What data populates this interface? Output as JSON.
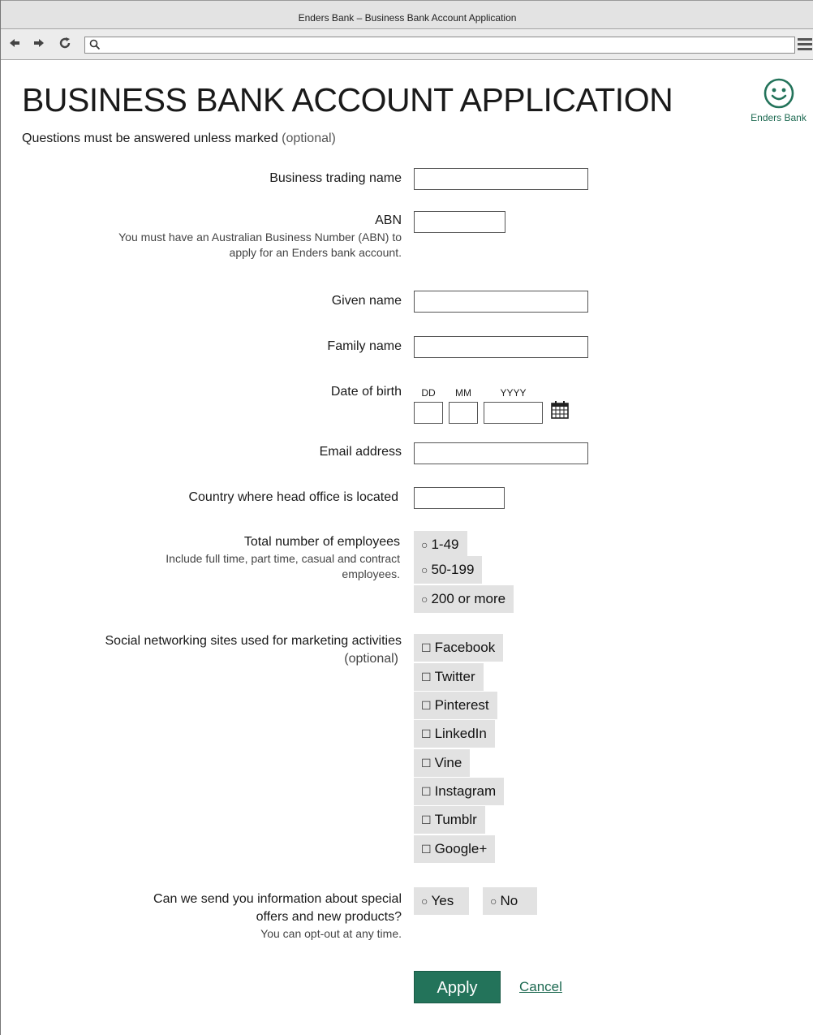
{
  "window": {
    "title": "Enders Bank – Business Bank Account Application"
  },
  "toolbar": {
    "back_icon": "arrow-left",
    "forward_icon": "arrow-right",
    "reload_icon": "reload",
    "search_icon": "magnifier",
    "menu_icon": "hamburger",
    "url_value": ""
  },
  "header": {
    "title": "BUSINESS BANK ACCOUNT APPLICATION",
    "brand_name": "Enders Bank",
    "brand_icon": "smiley-face",
    "intro_text": "Questions must be answered unless marked",
    "intro_optional": "(optional)"
  },
  "form": {
    "trading_name": {
      "label": "Business trading name",
      "value": ""
    },
    "abn": {
      "label": "ABN",
      "hint_line1": "You must have an Australian Business Number (ABN) to",
      "hint_line2": "apply for an Enders bank account.",
      "value": ""
    },
    "given_name": {
      "label": "Given name",
      "value": ""
    },
    "family_name": {
      "label": "Family name",
      "value": ""
    },
    "dob": {
      "label": "Date of birth",
      "day_label": "DD",
      "month_label": "MM",
      "year_label": "YYYY",
      "calendar_icon": "calendar"
    },
    "email": {
      "label": "Email address",
      "value": ""
    },
    "country": {
      "label": "Country where head office is located",
      "value": ""
    },
    "employees": {
      "label": "Total number of employees",
      "hint_line1": "Include full time, part time, casual and contract",
      "hint_line2": "employees.",
      "options": [
        "1-49",
        "50-199",
        "200 or more"
      ]
    },
    "social": {
      "label": "Social networking sites used for marketing activities",
      "optional": "(optional)",
      "options": [
        "Facebook",
        "Twitter",
        "Pinterest",
        "LinkedIn",
        "Vine",
        "Instagram",
        "Tumblr",
        "Google+"
      ]
    },
    "offers": {
      "label_line1": "Can we send you information about special",
      "label_line2": "offers and new products?",
      "hint": "You can opt-out at any time.",
      "options": [
        "Yes",
        "No"
      ]
    },
    "apply_label": "Apply",
    "cancel_label": "Cancel"
  },
  "colors": {
    "accent": "#23735a",
    "option_bg": "#e2e2e2",
    "chrome_bg": "#e3e3e3"
  }
}
